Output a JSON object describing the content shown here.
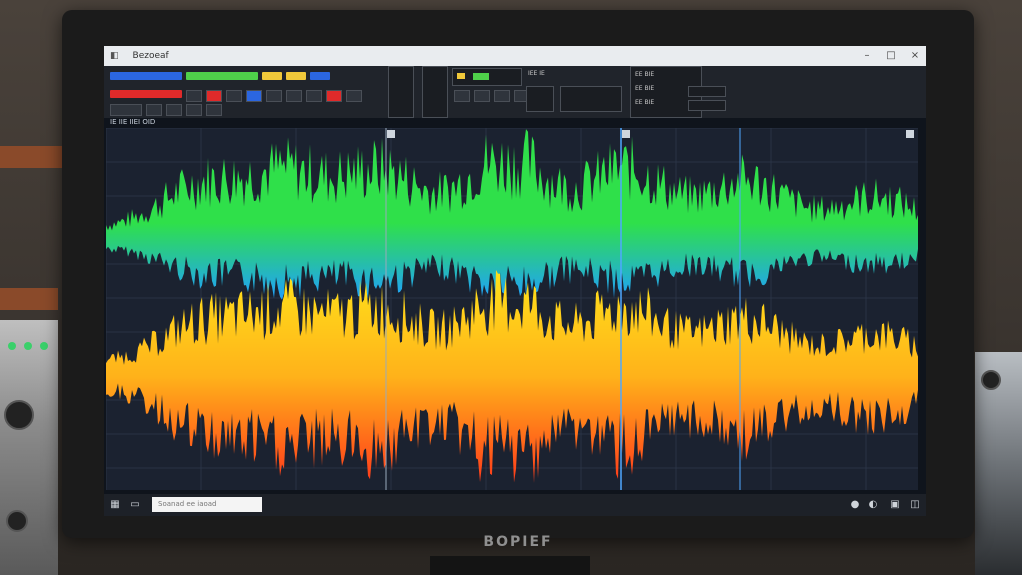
{
  "window": {
    "title": "Bezoeaf",
    "controls": [
      "–",
      "□",
      "×"
    ]
  },
  "monitor": {
    "brand": "BOPIEF"
  },
  "statusline": {
    "text": "IE IIE IIEI OID"
  },
  "toolbar": {
    "info_rows": [
      "EE BIE",
      "EE BIE",
      "EE BIE"
    ],
    "transport_label": "IEE IE"
  },
  "taskbar": {
    "search_placeholder": "Soanad ee iaoad"
  },
  "colors": {
    "top_wave_upper": "#2fe04a",
    "top_wave_lower": "#1fa0ff",
    "bottom_wave_upper": "#ffe21a",
    "bottom_wave_lower": "#ff3a1a",
    "grid": "#2a3345",
    "playhead": "#4fa8ff",
    "chip_blue": "#2b66e0",
    "chip_red": "#e02a2a",
    "chip_green": "#4fd04a",
    "chip_yellow": "#f0c83a"
  },
  "icons": {
    "start": "windows-icon",
    "app": "audio-app-icon",
    "tray": "tray-icons"
  }
}
